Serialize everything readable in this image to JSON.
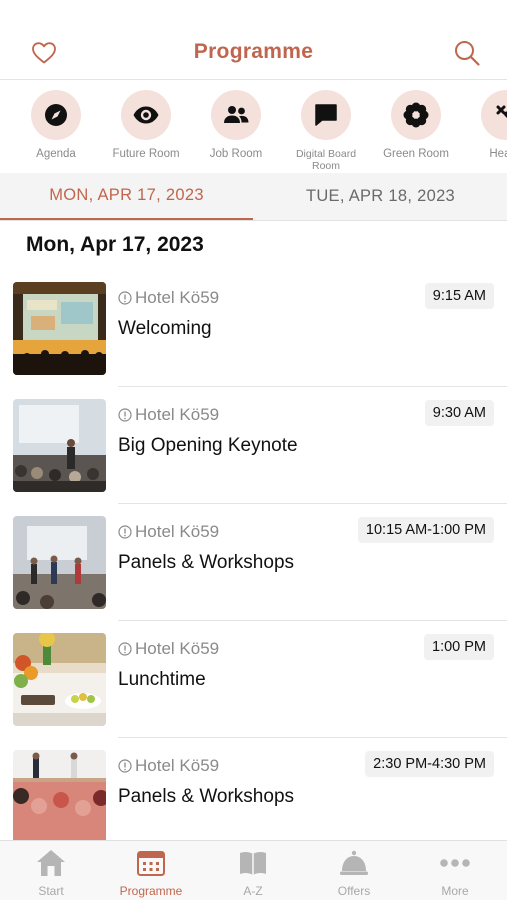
{
  "header": {
    "title": "Programme",
    "favorite_icon": "heart-icon",
    "search_icon": "search-icon"
  },
  "colors": {
    "accent": "#c0664e",
    "accent_light": "#f5e1db",
    "muted": "#8a8a8a"
  },
  "categories": [
    {
      "label": "Agenda",
      "icon": "compass-icon"
    },
    {
      "label": "Future Room",
      "icon": "eye-icon"
    },
    {
      "label": "Job Room",
      "icon": "people-icon"
    },
    {
      "label": "Digital Board Room",
      "icon": "chat-bubble-icon"
    },
    {
      "label": "Green Room",
      "icon": "flower-icon"
    },
    {
      "label": "Health",
      "icon": "health-icon"
    }
  ],
  "date_tabs": [
    {
      "label": "MON, APR 17, 2023",
      "active": true
    },
    {
      "label": "TUE, APR 18, 2023",
      "active": false
    }
  ],
  "day_heading": "Mon, Apr 17, 2023",
  "sessions": [
    {
      "location": "Hotel Kö59",
      "title": "Welcoming",
      "time": "9:15 AM",
      "image": "conference-stage-photo"
    },
    {
      "location": "Hotel Kö59",
      "title": "Big Opening Keynote",
      "time": "9:30 AM",
      "image": "keynote-speaker-photo"
    },
    {
      "location": "Hotel Kö59",
      "title": "Panels & Workshops",
      "time": "10:15 AM-1:00 PM",
      "image": "panel-discussion-photo"
    },
    {
      "location": "Hotel Kö59",
      "title": "Lunchtime",
      "time": "1:00 PM",
      "image": "buffet-photo"
    },
    {
      "location": "Hotel Kö59",
      "title": "Panels & Workshops",
      "time": "2:30 PM-4:30 PM",
      "image": "panel-stage-photo"
    }
  ],
  "tabbar": [
    {
      "label": "Start",
      "icon": "house-icon",
      "active": false
    },
    {
      "label": "Programme",
      "icon": "calendar-icon",
      "active": true
    },
    {
      "label": "A-Z",
      "icon": "book-icon",
      "active": false
    },
    {
      "label": "Offers",
      "icon": "bell-icon",
      "active": false
    },
    {
      "label": "More",
      "icon": "more-dots-icon",
      "active": false
    }
  ]
}
